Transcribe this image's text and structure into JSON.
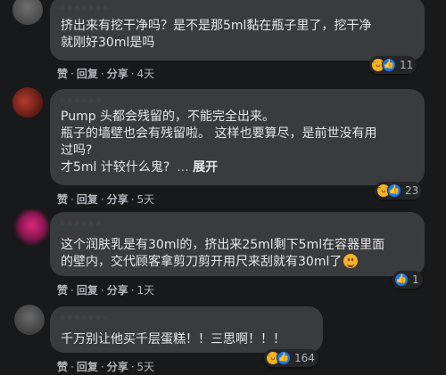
{
  "comments": [
    {
      "author": "· · ·    · · · ·",
      "lines": [
        "挤出来有挖干净吗？是不是那5ml黏在瓶子里了，挖干净",
        "就刚好30ml是吗"
      ],
      "actions": {
        "like": "赞",
        "reply": "回复",
        "share": "分享",
        "time": "4天"
      },
      "reaction_count": "11",
      "reactions": [
        "haha-icon",
        "like-icon"
      ]
    },
    {
      "author": "· · · ·  · ·",
      "lines": [
        "Pump 头都会残留的，不能完全出来。",
        "瓶子的墙壁也会有残留啦。 这样也要算尽，是前世没有用",
        "过吗?",
        "才5ml 计较什么鬼?"
      ],
      "see_more_prefix": "...",
      "see_more": "展开",
      "actions": {
        "like": "赞",
        "reply": "回复",
        "share": "分享",
        "time": "5天"
      },
      "reaction_count": "23",
      "reactions": [
        "haha-icon",
        "like-icon"
      ]
    },
    {
      "author": "· · · · · ·",
      "lines": [
        "这个润肤乳是有30ml的，挤出来25ml剩下5ml在容器里面",
        "的壁内，交代顾客拿剪刀剪开用尺来刮就有30ml了"
      ],
      "actions": {
        "like": "赞",
        "reply": "回复",
        "share": "分享",
        "time": "1天"
      },
      "reaction_count": "1",
      "reactions": [
        "like-icon"
      ]
    },
    {
      "author": "· · ·   · · · ·",
      "lines": [
        "千万别让他买千层蛋糕！！三思啊！！！"
      ],
      "actions": {
        "like": "赞",
        "reply": "回复",
        "share": "分享",
        "time": "5天"
      },
      "reaction_count": "164",
      "reactions": [
        "haha-icon",
        "like-icon"
      ]
    }
  ],
  "colors": {
    "background": "#18191a",
    "bubble": "#3a3b3c",
    "text": "#e4e6eb",
    "secondary": "#b0b3b8",
    "like_blue": "#1877f2",
    "haha_yellow": "#f7b125"
  }
}
